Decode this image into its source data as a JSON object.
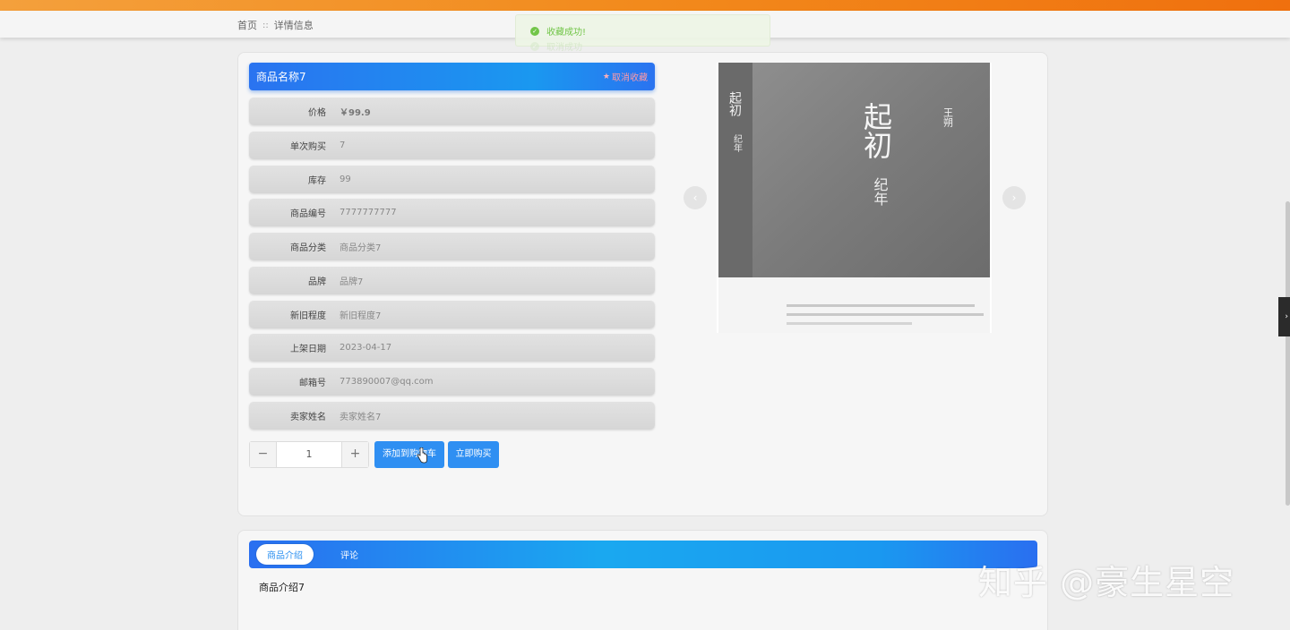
{
  "breadcrumb": {
    "home": "首页",
    "separator": "::",
    "current": "详情信息"
  },
  "toast": {
    "message": "收藏成功!",
    "ghost_message": "取消成功"
  },
  "product": {
    "name": "商品名称7",
    "favorite_toggle": "取消收藏",
    "fields": [
      {
        "label": "价格",
        "value": "￥99.9"
      },
      {
        "label": "单次购买",
        "value": "7"
      },
      {
        "label": "库存",
        "value": "99"
      },
      {
        "label": "商品编号",
        "value": "7777777777"
      },
      {
        "label": "商品分类",
        "value": "商品分类7"
      },
      {
        "label": "品牌",
        "value": "品牌7"
      },
      {
        "label": "新旧程度",
        "value": "新旧程度7"
      },
      {
        "label": "上架日期",
        "value": "2023-04-17"
      },
      {
        "label": "邮箱号",
        "value": "773890007@qq.com"
      },
      {
        "label": "卖家姓名",
        "value": "卖家姓名7"
      }
    ],
    "quantity": "1",
    "add_to_cart": "添加到购物车",
    "buy_now": "立即购买"
  },
  "book_cover": {
    "title_big": "起初",
    "subtitle": "纪年",
    "spine_title": "起初",
    "spine_sub": "纪年",
    "author": "王朔"
  },
  "tabs": {
    "items": [
      "商品介绍",
      "评论"
    ],
    "active": 0
  },
  "intro": "商品介绍7",
  "watermark": "知乎 @豪生星空",
  "colors": {
    "accent": "#2f8ff2",
    "top_strip": "#f28a1c",
    "success": "#67c23a",
    "favorite": "#ff9aa6"
  }
}
